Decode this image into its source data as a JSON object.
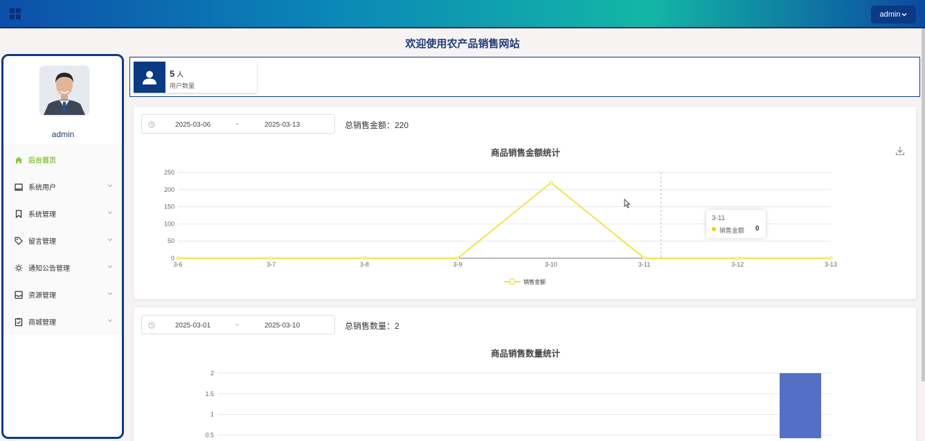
{
  "header": {
    "menu_icon": "grid-icon",
    "user_button": "admin"
  },
  "welcome": "欢迎使用农产品销售网站",
  "sidebar": {
    "username": "admin",
    "items": [
      {
        "label": "后台首页",
        "icon": "home-icon",
        "active": true
      },
      {
        "label": "系统用户",
        "icon": "monitor-icon"
      },
      {
        "label": "系统管理",
        "icon": "bookmark-icon"
      },
      {
        "label": "留言管理",
        "icon": "tag-icon"
      },
      {
        "label": "通知公告管理",
        "icon": "sun-icon"
      },
      {
        "label": "资源管理",
        "icon": "inbox-icon"
      },
      {
        "label": "商城管理",
        "icon": "clipboard-icon"
      }
    ]
  },
  "stat": {
    "value": "5",
    "unit": "人",
    "label": "用户数量"
  },
  "sales_amount": {
    "date_start": "2025-03-06",
    "date_sep": "-",
    "date_end": "2025-03-13",
    "total": "总销售金额：220",
    "tooltip": {
      "title": "3-11",
      "name": "销售金额",
      "value": "0"
    }
  },
  "sales_count": {
    "date_start": "2025-03-01",
    "date_sep": "-",
    "date_end": "2025-03-10",
    "total": "总销售数量：2"
  },
  "chart_data": [
    {
      "type": "line",
      "title": "商品销售金额统计",
      "categories": [
        "3-6",
        "3-7",
        "3-8",
        "3-9",
        "3-10",
        "3-11",
        "3-12",
        "3-13"
      ],
      "series": [
        {
          "name": "销售金额",
          "values": [
            0,
            0,
            0,
            0,
            220,
            0,
            0,
            0
          ]
        }
      ],
      "ylim": [
        0,
        250
      ],
      "yticks": [
        0,
        50,
        100,
        150,
        200,
        250
      ],
      "legend": "bottom",
      "grid": true,
      "color": "#f2e34a"
    },
    {
      "type": "bar",
      "title": "商品销售数量统计",
      "yticks_visible": [
        "0.5",
        "1",
        "1.5",
        "2"
      ],
      "ylim": [
        0,
        2
      ],
      "visible_bar_value": 2,
      "grid": true,
      "color": "#5470c6"
    }
  ]
}
